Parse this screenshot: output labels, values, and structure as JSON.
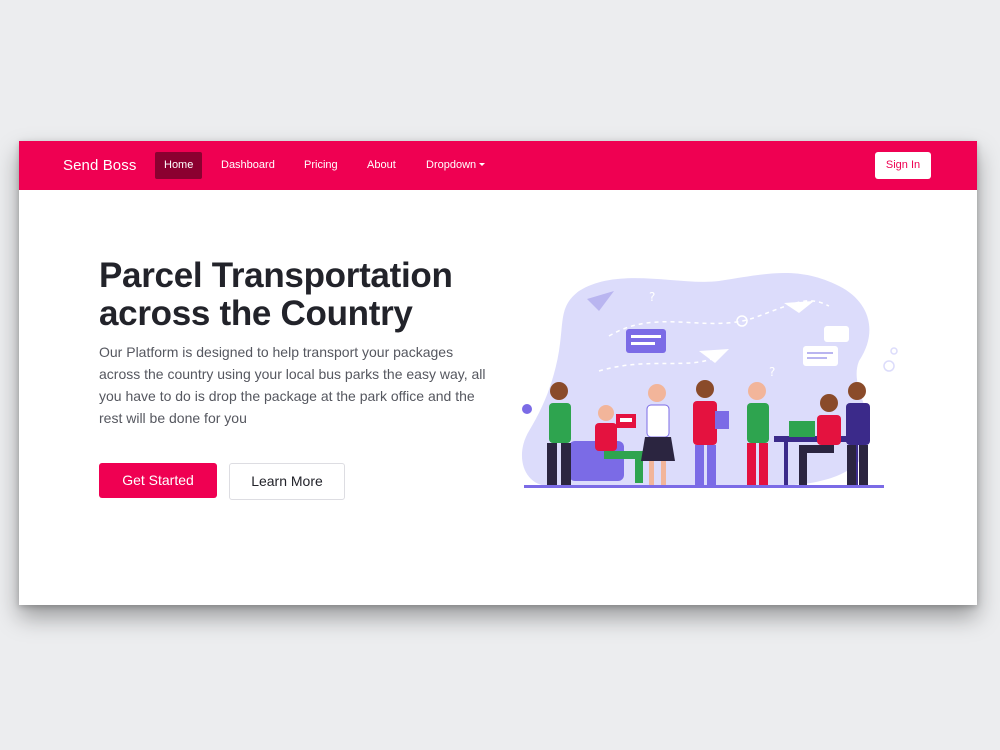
{
  "navbar": {
    "brand": "Send Boss",
    "links": [
      "Home",
      "Dashboard",
      "Pricing",
      "About",
      "Dropdown"
    ],
    "active": "Home",
    "signin": "Sign In"
  },
  "hero": {
    "title": "Parcel Transportation across the Country",
    "text": "Our Platform is designed to help transport your packages across the country using your local bus parks the easy way, all you have to do is drop the package at the park office and the rest will be done for you",
    "primary_button": "Get Started",
    "secondary_button": "Learn More"
  },
  "colors": {
    "brand": "#ef0052",
    "active_nav": "#8b0030",
    "illustration_bg": "#dcdcfb",
    "illustration_purple": "#7b6be6"
  }
}
